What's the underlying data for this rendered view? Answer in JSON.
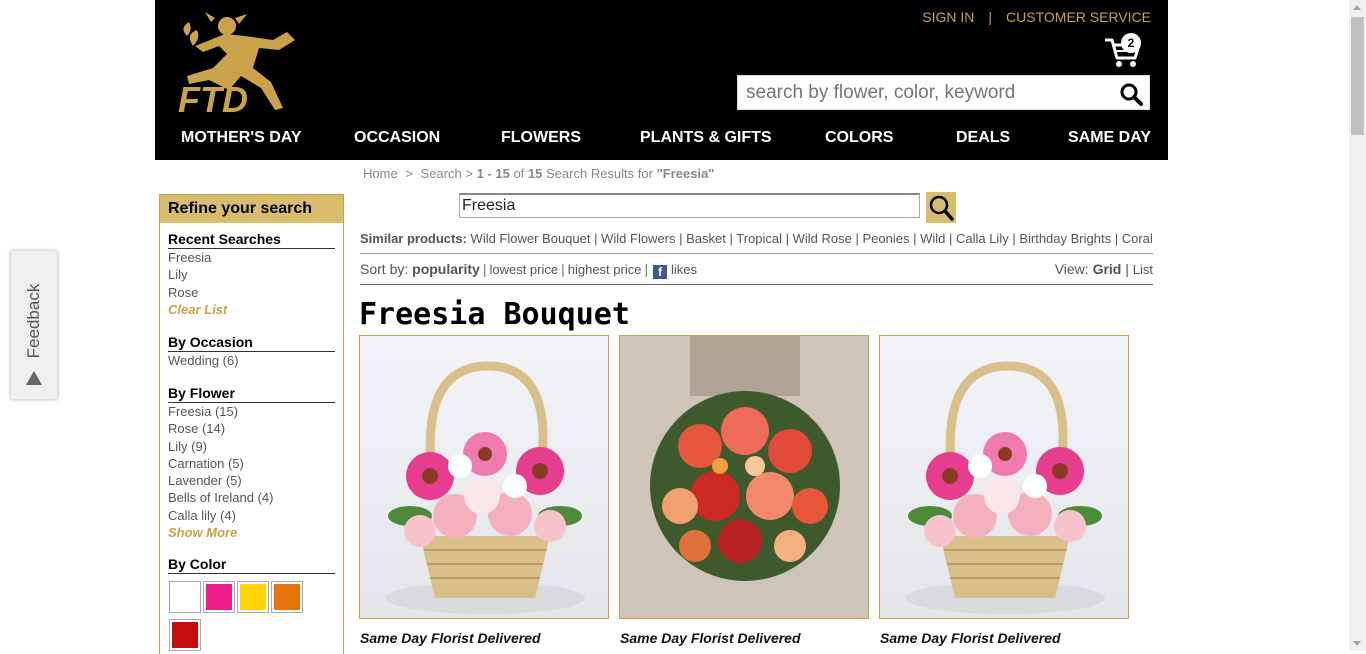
{
  "header": {
    "logo_text": "FTD",
    "sign_in": "SIGN IN",
    "separator": "|",
    "customer_service": "CUSTOMER SERVICE",
    "cart_count": "2",
    "search_placeholder": "search by flower, color, keyword",
    "nav": [
      "MOTHER'S DAY",
      "OCCASION",
      "FLOWERS",
      "PLANTS & GIFTS",
      "COLORS",
      "DEALS",
      "SAME DAY"
    ]
  },
  "feedback": {
    "label": "Feedback"
  },
  "breadcrumb": {
    "home": "Home",
    "sep1": ">",
    "search": "Search",
    "sep2": ">",
    "range": "1 - 15",
    "of": "of",
    "total": "15",
    "results_text": "Search Results for",
    "query": "\"Freesia\""
  },
  "refine": {
    "title": "Refine your search",
    "recent": {
      "heading": "Recent Searches",
      "items": [
        "Freesia",
        "Lily",
        "Rose"
      ],
      "clear": "Clear List"
    },
    "occasion": {
      "heading": "By Occasion",
      "items": [
        "Wedding (6)"
      ]
    },
    "flower": {
      "heading": "By Flower",
      "items": [
        "Freesia (15)",
        "Rose (14)",
        "Lily (9)",
        "Carnation (5)",
        "Lavender (5)",
        "Bells of Ireland (4)",
        "Calla lily (4)"
      ],
      "more": "Show More"
    },
    "color": {
      "heading": "By Color",
      "swatches": [
        "#ffffff",
        "#ee1c8c",
        "#ffd400",
        "#e8730a",
        "#c50d0d"
      ]
    }
  },
  "search": {
    "value": "Freesia"
  },
  "similar": {
    "label": "Similar products:",
    "items": [
      "Wild Flower Bouquet",
      "Wild Flowers",
      "Basket",
      "Tropical",
      "Wild Rose",
      "Peonies",
      "Wild",
      "Calla Lily",
      "Birthday Brights",
      "Coral"
    ]
  },
  "sort": {
    "label": "Sort by:",
    "current": "popularity",
    "options": [
      "lowest price",
      "highest price"
    ],
    "likes": "likes",
    "fb_icon": "f"
  },
  "view": {
    "label": "View:",
    "grid": "Grid",
    "sep": "|",
    "list": "List"
  },
  "section_title": "Freesia Bouquet",
  "products": [
    {
      "label": "Same Day Florist Delivered",
      "image": "pink-basket-bouquet"
    },
    {
      "label": "Same Day Florist Delivered",
      "image": "red-hand-bouquet"
    },
    {
      "label": "Same Day Florist Delivered",
      "image": "pink-basket-bouquet"
    }
  ]
}
